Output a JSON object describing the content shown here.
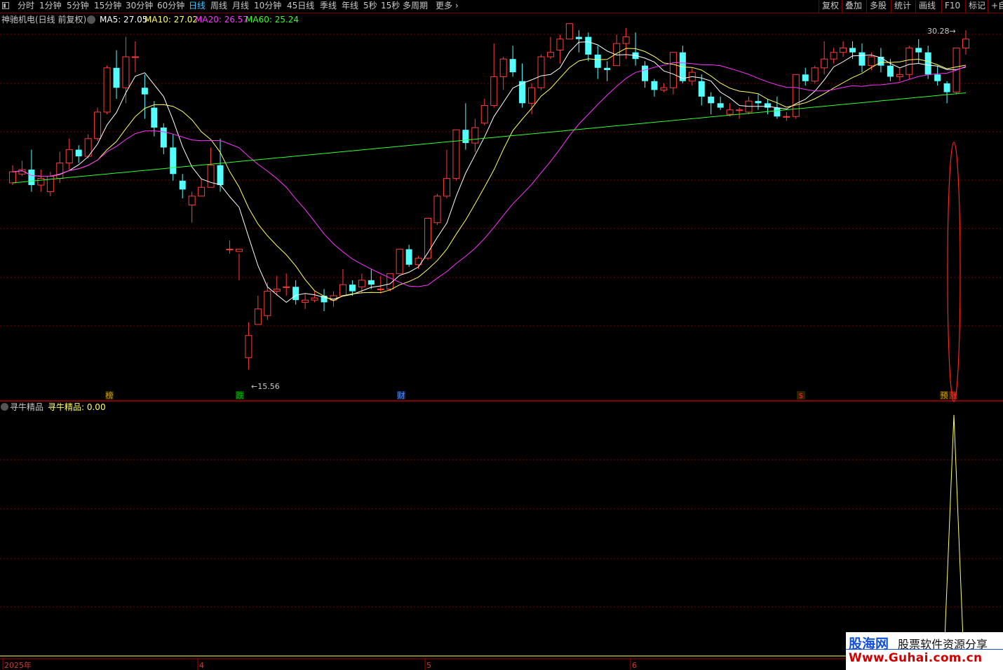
{
  "toolbar": {
    "periods": [
      "分时",
      "1分钟",
      "5分钟",
      "15分钟",
      "30分钟",
      "60分钟",
      "日线",
      "周线",
      "月线",
      "10分钟",
      "45日线",
      "季线",
      "年线",
      "5秒",
      "15秒",
      "多周期",
      "更多"
    ],
    "active_period": "日线",
    "right_tools": [
      "复权",
      "叠加",
      "多股",
      "统计",
      "画线",
      "F10",
      "标记",
      "+自"
    ]
  },
  "header": {
    "stock_label": "神驰机电(日线 前复权)",
    "ma5": "MA5: 27.05",
    "ma10": "MA10: 27.02",
    "ma20": "MA20: 26.57",
    "ma60": "MA60: 25.24"
  },
  "indicator": {
    "name": "寻牛精品",
    "value_label": "寻牛精品: 0.00"
  },
  "price_labels": {
    "high": "30.28",
    "low": "15.56"
  },
  "event_markers": [
    {
      "text": "榜",
      "color": "#c8a000"
    },
    {
      "text": "跌",
      "color": "#00b000"
    },
    {
      "text": "财",
      "color": "#4a8cff"
    },
    {
      "text": "$",
      "color": "#ff2020"
    },
    {
      "text": "预",
      "color": "#c8a000"
    },
    {
      "text": "涨",
      "color": "#ff3030"
    }
  ],
  "time_axis": [
    "2025年",
    "4",
    "5",
    "6"
  ],
  "colors": {
    "up": "#ff3c3c",
    "down": "#54ffff",
    "ma5": "#ffffff",
    "ma10": "#ffff64",
    "ma20": "#ff32ff",
    "ma60": "#32ff32",
    "grid": "#7a0000"
  },
  "watermark": {
    "brand": "股海网",
    "slogan": "股票软件资源分享",
    "url": "Www.Guhai.com.cn"
  },
  "chart_data": {
    "type": "candlestick",
    "title": "神驰机电(日线 前复权)",
    "ylim": [
      15.0,
      31.0
    ],
    "candles": [
      [
        24.0,
        24.8,
        24.5,
        23.9
      ],
      [
        24.4,
        25.0,
        24.6,
        24.3
      ],
      [
        24.6,
        25.5,
        23.9,
        23.6
      ],
      [
        23.9,
        24.6,
        24.2,
        23.6
      ],
      [
        23.6,
        24.5,
        24.3,
        23.4
      ],
      [
        24.2,
        25.4,
        24.9,
        24.0
      ],
      [
        24.9,
        26.0,
        25.5,
        24.6
      ],
      [
        25.5,
        25.7,
        25.2,
        24.9
      ],
      [
        25.2,
        26.2,
        26.0,
        25.1
      ],
      [
        26.0,
        27.4,
        27.2,
        25.9
      ],
      [
        27.2,
        29.3,
        29.2,
        27.1
      ],
      [
        29.2,
        30.0,
        28.3,
        27.8
      ],
      [
        28.3,
        30.6,
        29.7,
        27.6
      ],
      [
        29.7,
        30.4,
        29.7,
        29.0
      ],
      [
        28.3,
        28.9,
        28.0,
        26.9
      ],
      [
        27.4,
        27.7,
        26.5,
        26.1
      ],
      [
        26.5,
        26.7,
        25.6,
        25.3
      ],
      [
        25.6,
        26.2,
        24.4,
        24.1
      ],
      [
        24.1,
        24.4,
        23.7,
        23.3
      ],
      [
        23.0,
        23.6,
        23.4,
        22.2
      ],
      [
        23.4,
        24.2,
        23.8,
        23.6
      ],
      [
        23.8,
        25.6,
        24.8,
        23.9
      ],
      [
        24.8,
        26.0,
        23.9,
        23.6
      ],
      [
        21.0,
        21.4,
        21.0,
        20.8
      ],
      [
        20.9,
        20.8,
        21.0,
        19.6
      ],
      [
        16.1,
        17.7,
        17.1,
        15.56
      ],
      [
        17.6,
        18.9,
        18.3,
        17.7
      ],
      [
        18.0,
        19.5,
        19.1,
        17.8
      ],
      [
        19.1,
        19.8,
        19.2,
        18.9
      ],
      [
        19.3,
        19.9,
        19.3,
        18.9
      ],
      [
        19.3,
        19.6,
        18.7,
        18.5
      ],
      [
        18.6,
        19.0,
        18.7,
        18.3
      ],
      [
        18.7,
        19.1,
        18.8,
        18.6
      ],
      [
        18.9,
        19.2,
        18.6,
        18.2
      ],
      [
        18.7,
        19.1,
        18.9,
        18.4
      ],
      [
        18.9,
        20.1,
        19.4,
        18.9
      ],
      [
        19.4,
        19.6,
        19.1,
        18.9
      ],
      [
        19.3,
        19.9,
        19.6,
        19.0
      ],
      [
        19.6,
        20.1,
        19.4,
        19.2
      ],
      [
        19.2,
        19.8,
        19.2,
        19.0
      ],
      [
        19.2,
        19.7,
        19.9,
        19.1
      ],
      [
        19.9,
        21.0,
        21.0,
        19.9
      ],
      [
        21.0,
        21.2,
        20.3,
        20.2
      ],
      [
        20.3,
        20.7,
        20.6,
        20.1
      ],
      [
        20.6,
        22.4,
        22.4,
        20.5
      ],
      [
        22.2,
        23.5,
        23.4,
        22.1
      ],
      [
        23.4,
        25.5,
        24.2,
        23.3
      ],
      [
        24.2,
        26.4,
        26.4,
        24.1
      ],
      [
        26.4,
        27.6,
        25.8,
        25.5
      ],
      [
        25.8,
        26.9,
        26.5,
        25.4
      ],
      [
        26.7,
        27.8,
        27.5,
        26.6
      ],
      [
        27.5,
        30.3,
        28.8,
        27.4
      ],
      [
        28.8,
        29.7,
        29.6,
        28.2
      ],
      [
        29.6,
        30.2,
        29.0,
        28.8
      ],
      [
        28.6,
        29.4,
        27.6,
        27.4
      ],
      [
        27.6,
        28.5,
        28.3,
        27.1
      ],
      [
        28.3,
        29.8,
        29.7,
        28.2
      ],
      [
        29.7,
        30.6,
        29.9,
        29.6
      ],
      [
        30.0,
        30.7,
        30.5,
        29.4
      ],
      [
        30.5,
        31.0,
        31.2,
        30.5
      ],
      [
        30.6,
        30.9,
        30.5,
        29.9
      ],
      [
        30.6,
        30.8,
        29.8,
        29.5
      ],
      [
        29.8,
        30.2,
        29.2,
        28.7
      ],
      [
        29.2,
        29.5,
        29.1,
        28.6
      ],
      [
        29.3,
        30.7,
        30.3,
        29.3
      ],
      [
        30.3,
        31.0,
        30.6,
        29.6
      ],
      [
        29.9,
        30.8,
        29.6,
        29.3
      ],
      [
        29.3,
        29.5,
        28.6,
        28.3
      ],
      [
        28.6,
        28.7,
        28.2,
        27.9
      ],
      [
        28.2,
        28.5,
        28.3,
        28.1
      ],
      [
        28.3,
        28.5,
        29.9,
        28.0
      ],
      [
        29.9,
        30.2,
        28.6,
        28.5
      ],
      [
        28.6,
        29.2,
        29.0,
        28.4
      ],
      [
        28.6,
        28.9,
        27.9,
        27.5
      ],
      [
        27.9,
        28.1,
        27.6,
        27.1
      ],
      [
        27.6,
        27.9,
        27.4,
        27.3
      ],
      [
        27.1,
        27.6,
        27.3,
        27.0
      ],
      [
        27.3,
        27.4,
        27.3,
        26.9
      ],
      [
        27.2,
        27.9,
        27.7,
        27.1
      ],
      [
        27.7,
        28.0,
        27.6,
        27.3
      ],
      [
        27.6,
        27.8,
        27.4,
        27.1
      ],
      [
        27.4,
        27.9,
        27.0,
        26.9
      ],
      [
        27.0,
        27.2,
        27.0,
        26.8
      ],
      [
        27.0,
        28.9,
        28.9,
        26.9
      ],
      [
        28.9,
        29.2,
        28.6,
        28.4
      ],
      [
        28.6,
        29.3,
        29.2,
        28.5
      ],
      [
        29.2,
        30.4,
        29.6,
        28.9
      ],
      [
        29.6,
        30.1,
        29.9,
        29.4
      ],
      [
        29.9,
        30.4,
        30.1,
        29.7
      ],
      [
        30.1,
        30.4,
        29.9,
        29.6
      ],
      [
        29.9,
        30.3,
        29.3,
        29.0
      ],
      [
        29.3,
        29.9,
        29.7,
        29.1
      ],
      [
        29.7,
        30.1,
        29.3,
        29.0
      ],
      [
        29.3,
        29.6,
        28.8,
        28.6
      ],
      [
        28.8,
        29.2,
        28.9,
        28.6
      ],
      [
        28.9,
        30.2,
        30.1,
        28.7
      ],
      [
        30.1,
        30.5,
        29.9,
        29.4
      ],
      [
        29.9,
        30.2,
        28.9,
        28.7
      ],
      [
        28.9,
        29.3,
        28.6,
        28.4
      ],
      [
        28.5,
        28.6,
        28.1,
        27.6
      ],
      [
        28.1,
        29.0,
        30.1,
        28.0
      ],
      [
        30.1,
        30.9,
        30.5,
        29.8
      ]
    ],
    "indicator_series": {
      "name": "寻牛精品",
      "last_value": 0.0,
      "peak_value": 1.0
    }
  }
}
